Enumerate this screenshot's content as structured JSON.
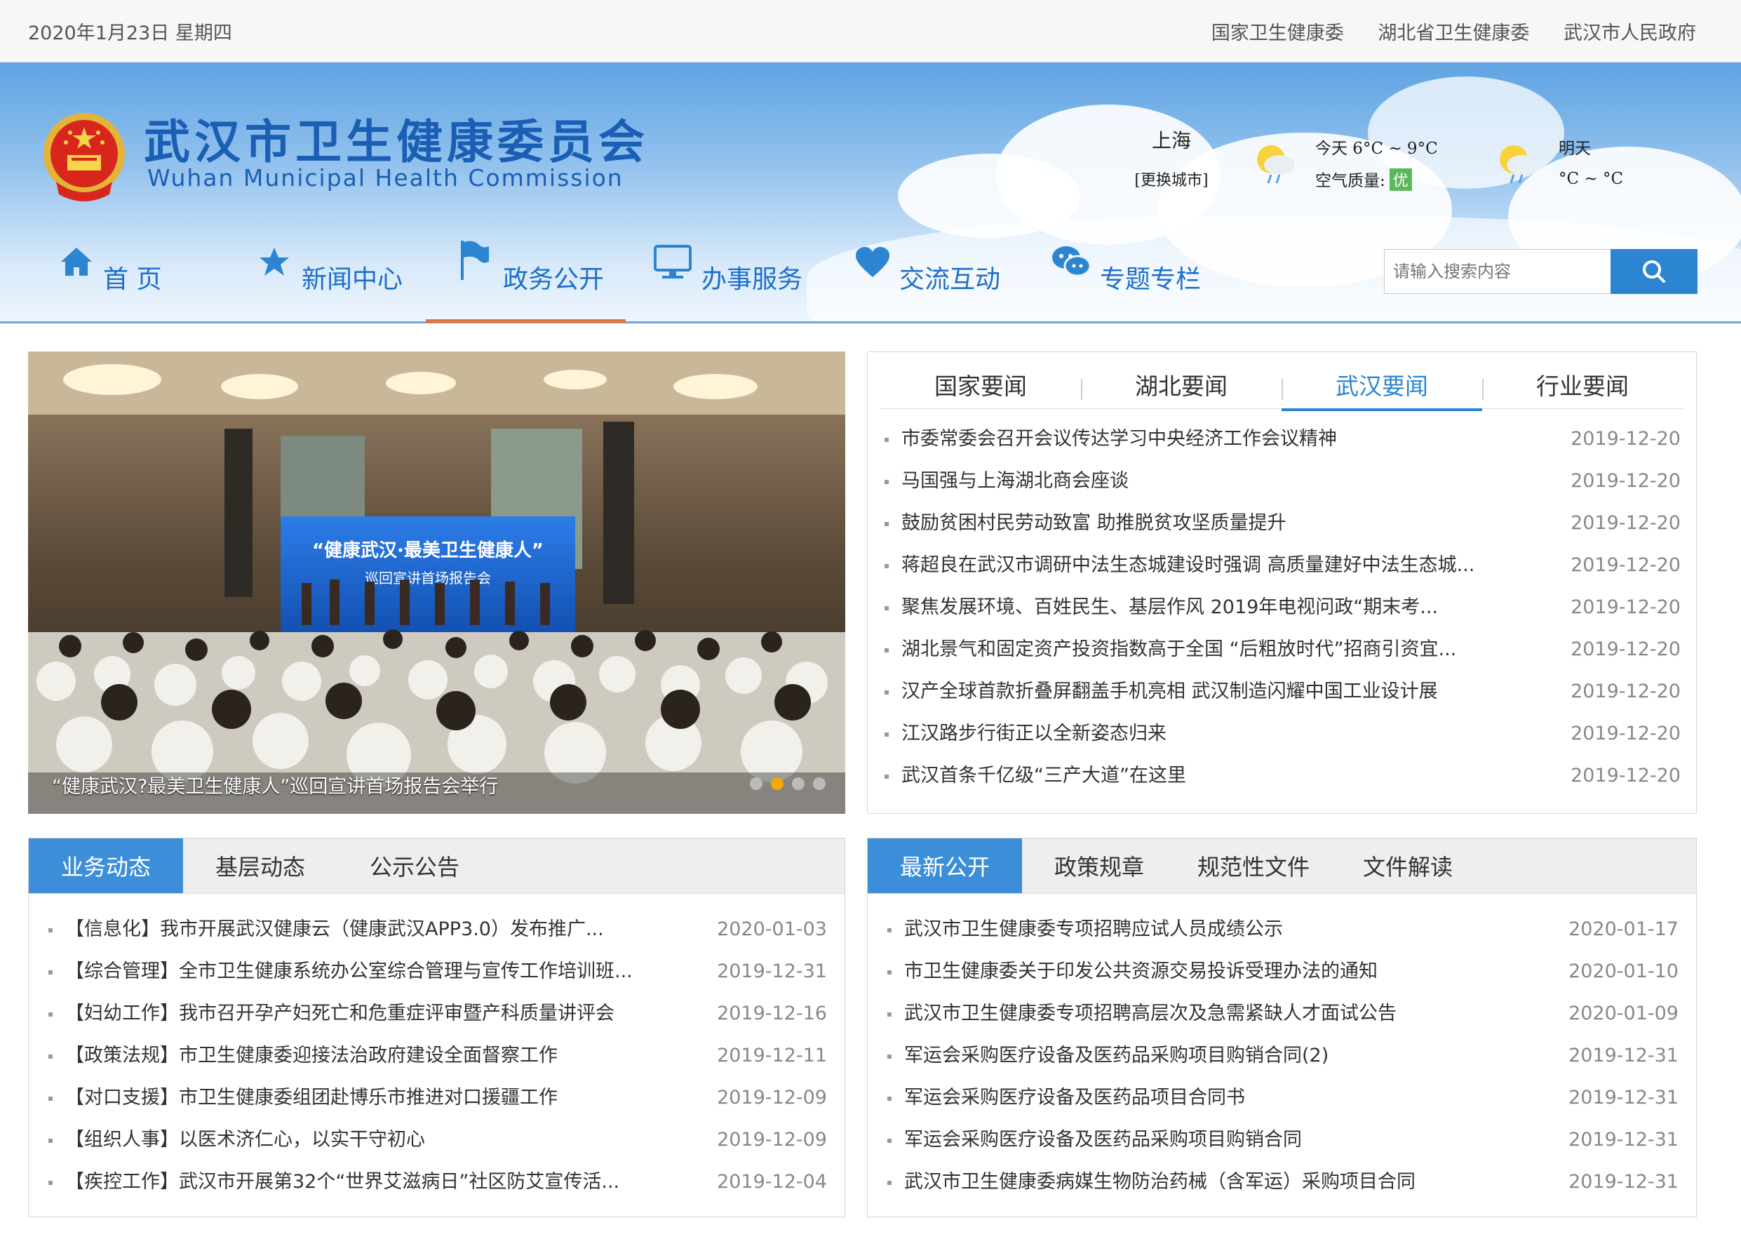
{
  "topbar": {
    "date": "2020年1月23日 星期四",
    "links": [
      "国家卫生健康委",
      "湖北省卫生健康委",
      "武汉市人民政府"
    ]
  },
  "header": {
    "title_cn": "武汉市卫生健康委员会",
    "title_en": "Wuhan Municipal Health Commission",
    "brand_color": "#1a5fb4"
  },
  "weather": {
    "city": "上海",
    "change_city": "[更换城市]",
    "today_temp": "今天  6°C ~ 9°C",
    "air_quality_label": "空气质量:",
    "air_quality_value": "优",
    "tomorrow_label": "明天",
    "tomorrow_temp": "°C ~ °C",
    "icon": "sun-cloud-rain-icon"
  },
  "nav": {
    "items": [
      {
        "label": "首  页",
        "icon": "home-icon"
      },
      {
        "label": "新闻中心",
        "icon": "star-icon"
      },
      {
        "label": "政务公开",
        "icon": "flag-icon"
      },
      {
        "label": "办事服务",
        "icon": "monitor-icon"
      },
      {
        "label": "交流互动",
        "icon": "heart-icon"
      },
      {
        "label": "专题专栏",
        "icon": "chat-icon"
      }
    ],
    "active_index": 2,
    "accent_color": "#e8733a"
  },
  "search": {
    "placeholder": "请输入搜索内容",
    "button_icon": "search-icon"
  },
  "hero": {
    "caption": "“健康武汉?最美卫生健康人”巡回宣讲首场报告会举行",
    "banner_line1": "“健康武汉·最美卫生健康人”",
    "banner_line2": "巡回宣讲首场报告会",
    "slides": 4,
    "active_slide": 2
  },
  "news": {
    "tabs": [
      "国家要闻",
      "湖北要闻",
      "武汉要闻",
      "行业要闻"
    ],
    "active_tab": 2,
    "items": [
      {
        "title": "市委常委会召开会议传达学习中央经济工作会议精神",
        "date": "2019-12-20"
      },
      {
        "title": "马国强与上海湖北商会座谈",
        "date": "2019-12-20"
      },
      {
        "title": "鼓励贫困村民劳动致富 助推脱贫攻坚质量提升",
        "date": "2019-12-20"
      },
      {
        "title": "蒋超良在武汉市调研中法生态城建设时强调 高质量建好中法生态城...",
        "date": "2019-12-20"
      },
      {
        "title": "聚焦发展环境、百姓民生、基层作风 2019年电视问政“期末考...",
        "date": "2019-12-20"
      },
      {
        "title": "湖北景气和固定资产投资指数高于全国 “后粗放时代”招商引资宜...",
        "date": "2019-12-20"
      },
      {
        "title": "汉产全球首款折叠屏翻盖手机亮相 武汉制造闪耀中国工业设计展",
        "date": "2019-12-20"
      },
      {
        "title": "江汉路步行街正以全新姿态归来",
        "date": "2019-12-20"
      },
      {
        "title": "武汉首条千亿级“三产大道”在这里",
        "date": "2019-12-20"
      }
    ]
  },
  "business": {
    "tabs": [
      "业务动态",
      "基层动态",
      "公示公告"
    ],
    "active_tab": 0,
    "items": [
      {
        "title": "【信息化】我市开展武汉健康云（健康武汉APP3.0）发布推广...",
        "date": "2020-01-03"
      },
      {
        "title": "【综合管理】全市卫生健康系统办公室综合管理与宣传工作培训班...",
        "date": "2019-12-31"
      },
      {
        "title": "【妇幼工作】我市召开孕产妇死亡和危重症评审暨产科质量讲评会",
        "date": "2019-12-16"
      },
      {
        "title": "【政策法规】市卫生健康委迎接法治政府建设全面督察工作",
        "date": "2019-12-11"
      },
      {
        "title": "【对口支援】市卫生健康委组团赴博乐市推进对口援疆工作",
        "date": "2019-12-09"
      },
      {
        "title": "【组织人事】以医术济仁心，以实干守初心",
        "date": "2019-12-09"
      },
      {
        "title": "【疾控工作】武汉市开展第32个“世界艾滋病日”社区防艾宣传活...",
        "date": "2019-12-04"
      }
    ]
  },
  "disclosure": {
    "tabs": [
      "最新公开",
      "政策规章",
      "规范性文件",
      "文件解读"
    ],
    "active_tab": 0,
    "items": [
      {
        "title": "武汉市卫生健康委专项招聘应试人员成绩公示",
        "date": "2020-01-17"
      },
      {
        "title": "市卫生健康委关于印发公共资源交易投诉受理办法的通知",
        "date": "2020-01-10"
      },
      {
        "title": "武汉市卫生健康委专项招聘高层次及急需紧缺人才面试公告",
        "date": "2020-01-09"
      },
      {
        "title": "军运会采购医疗设备及医药品采购项目购销合同(2)",
        "date": "2019-12-31"
      },
      {
        "title": "军运会采购医疗设备及医药品项目合同书",
        "date": "2019-12-31"
      },
      {
        "title": "军运会采购医疗设备及医药品采购项目购销合同",
        "date": "2019-12-31"
      },
      {
        "title": "武汉市卫生健康委病媒生物防治药械（含军运）采购项目合同",
        "date": "2019-12-31"
      }
    ]
  },
  "colors": {
    "primary_blue": "#2b85d0",
    "tab_blue": "#3d8ed8",
    "slide_dot_active": "#f2a900"
  }
}
